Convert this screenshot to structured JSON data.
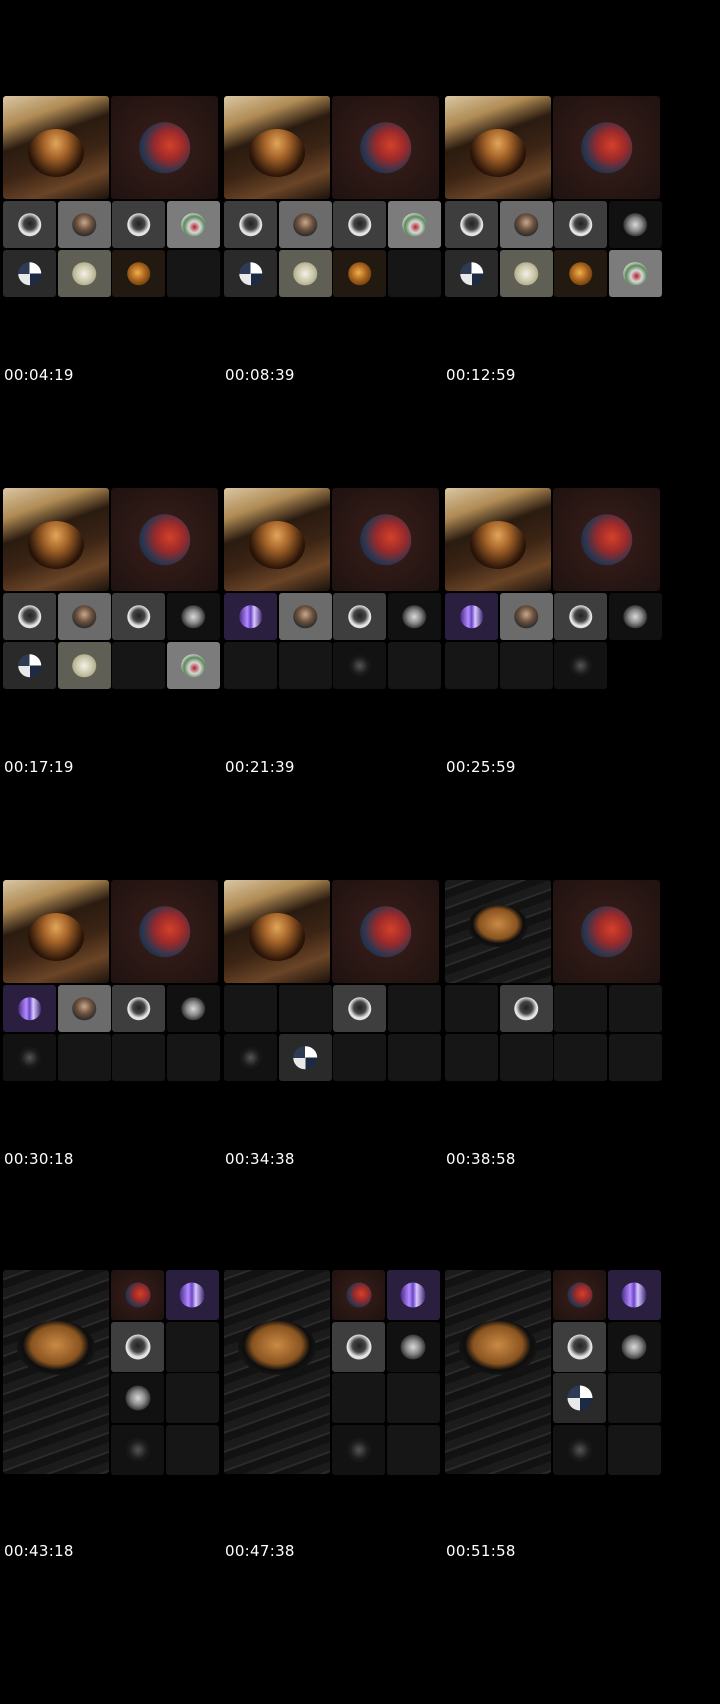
{
  "timestamps": [
    "00:04:19",
    "00:08:39",
    "00:12:59",
    "00:17:19",
    "00:21:39",
    "00:25:59",
    "00:30:18",
    "00:34:38",
    "00:38:58",
    "00:43:18",
    "00:47:38",
    "00:51:58"
  ],
  "tile_icons": {
    "coffee-book": "coffee-with-book",
    "coffee-plank": "coffee-cup-on-plank",
    "portrait-red": "red-portrait-avatar",
    "man": "bearded-man-avatar",
    "silhouette": "silhouette-avatar",
    "flowers": "flowers-avatar",
    "dark-figure": "dark-figure-avatar",
    "mosaic": "mosaic-avatar",
    "sketch": "sketch-avatar",
    "golden": "golden-avatar",
    "purple": "purple-light-avatar",
    "white-face": "white-face-avatar"
  },
  "colors": {
    "background": "#000000",
    "tile": "#1a1a1a",
    "timestamp": "#ffffff"
  }
}
